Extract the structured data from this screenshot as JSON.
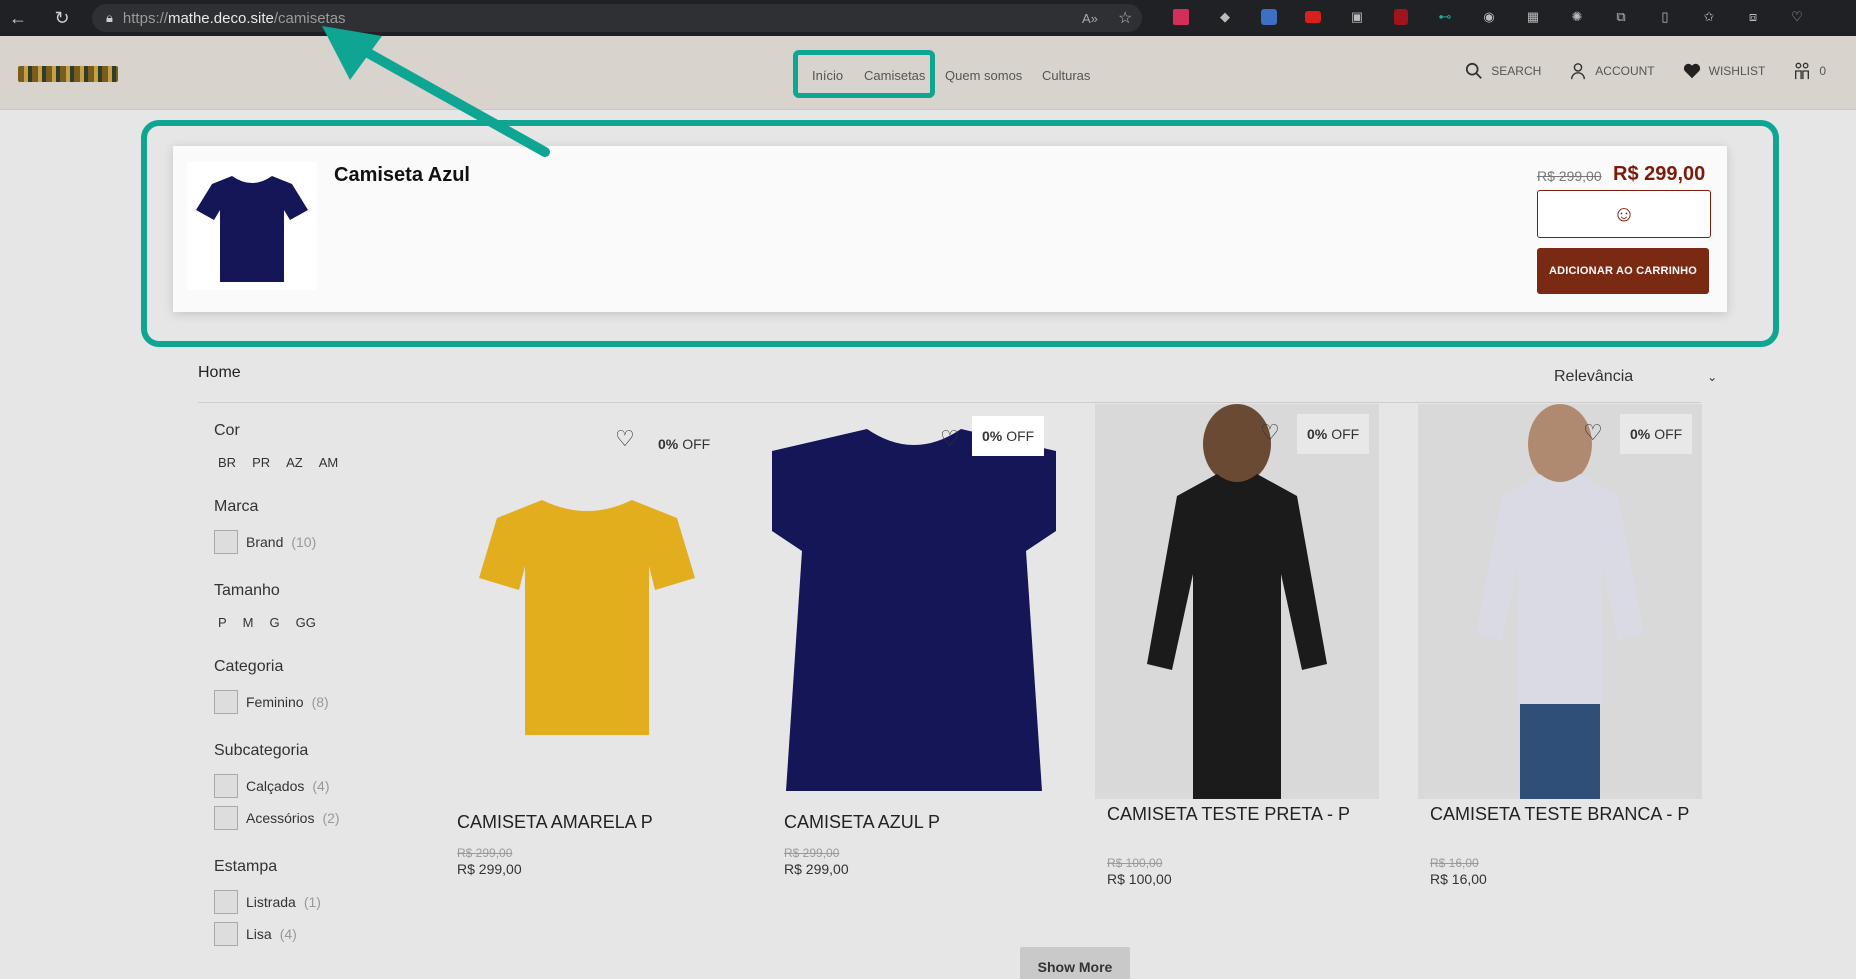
{
  "browser": {
    "url_prefix": "https://",
    "url_host": "mathe.deco.site",
    "url_path": "/camisetas"
  },
  "header": {
    "nav": [
      "Início",
      "Camisetas",
      "Quem somos",
      "Culturas"
    ],
    "search_label": "SEARCH",
    "account_label": "ACCOUNT",
    "wishlist_label": "WISHLIST",
    "cart_count": "0"
  },
  "popup": {
    "title": "Camiseta Azul",
    "old_price": "R$ 299,00",
    "price": "R$ 299,00",
    "add_label": "ADICIONAR AO CARRINHO",
    "select_icon": "smile-icon"
  },
  "breadcrumb": "Home",
  "sort": {
    "selected": "Relevância"
  },
  "filters": {
    "cor": {
      "title": "Cor",
      "options": [
        "BR",
        "PR",
        "AZ",
        "AM"
      ]
    },
    "marca": {
      "title": "Marca",
      "items": [
        {
          "label": "Brand",
          "count": "(10)"
        }
      ]
    },
    "tamanho": {
      "title": "Tamanho",
      "options": [
        "P",
        "M",
        "G",
        "GG"
      ]
    },
    "categoria": {
      "title": "Categoria",
      "items": [
        {
          "label": "Feminino",
          "count": "(8)"
        }
      ]
    },
    "subcategoria": {
      "title": "Subcategoria",
      "items": [
        {
          "label": "Calçados",
          "count": "(4)"
        },
        {
          "label": "Acessórios",
          "count": "(2)"
        }
      ]
    },
    "estampa": {
      "title": "Estampa",
      "items": [
        {
          "label": "Listrada",
          "count": "(1)"
        },
        {
          "label": "Lisa",
          "count": "(4)"
        }
      ]
    }
  },
  "products": [
    {
      "name": "CAMISETA AMARELA P",
      "old_price": "R$ 299,00",
      "price": "R$ 299,00",
      "discount_pct": "0%",
      "discount_word": "OFF",
      "color": "#e2ae1e"
    },
    {
      "name": "CAMISETA AZUL P",
      "old_price": "R$ 299,00",
      "price": "R$ 299,00",
      "discount_pct": "0%",
      "discount_word": "OFF",
      "color": "#141657"
    },
    {
      "name": "CAMISETA TESTE PRETA - P",
      "old_price": "R$ 100,00",
      "price": "R$ 100,00",
      "discount_pct": "0%",
      "discount_word": "OFF",
      "color": "#1b1b1b"
    },
    {
      "name": "CAMISETA TESTE BRANCA - P",
      "old_price": "R$ 16,00",
      "price": "R$ 16,00",
      "discount_pct": "0%",
      "discount_word": "OFF",
      "color": "#d9dae4"
    }
  ],
  "show_more": "Show More",
  "colors": {
    "accent": "#0fa593",
    "brand": "#7a2a13"
  }
}
